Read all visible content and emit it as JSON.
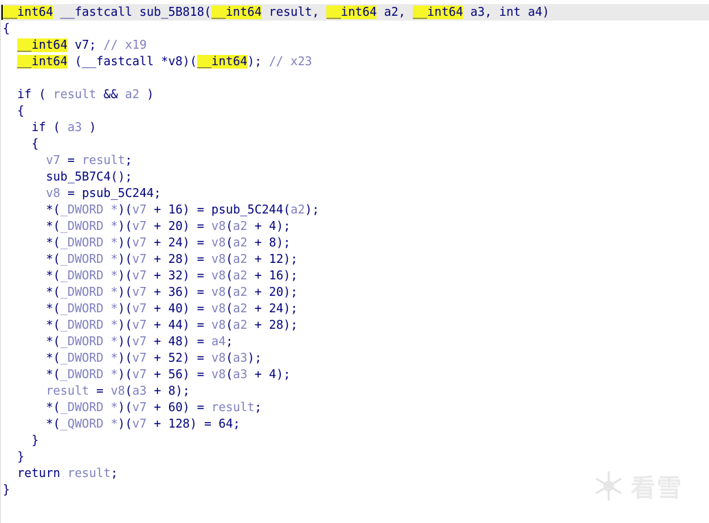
{
  "lines": [
    [
      [
        "hl",
        "__int64"
      ],
      [
        "t",
        " __fastcall sub_5B818("
      ],
      [
        "hl",
        "__int64"
      ],
      [
        "t",
        " result, "
      ],
      [
        "hl",
        "__int64"
      ],
      [
        "t",
        " a2, "
      ],
      [
        "hl",
        "__int64"
      ],
      [
        "t",
        " a3, int a4)"
      ]
    ],
    [
      [
        "t",
        "{"
      ]
    ],
    [
      [
        "t",
        "  "
      ],
      [
        "hl",
        "__int64"
      ],
      [
        "t",
        " v7; "
      ],
      [
        "c",
        "// x19"
      ]
    ],
    [
      [
        "t",
        "  "
      ],
      [
        "hl",
        "__int64"
      ],
      [
        "t",
        " (__fastcall *v8)("
      ],
      [
        "hl",
        "__int64"
      ],
      [
        "t",
        "); "
      ],
      [
        "c",
        "// x23"
      ]
    ],
    [
      [
        "t",
        ""
      ]
    ],
    [
      [
        "t",
        "  if ( "
      ],
      [
        "v",
        "result"
      ],
      [
        "t",
        " && "
      ],
      [
        "v",
        "a2"
      ],
      [
        "t",
        " )"
      ]
    ],
    [
      [
        "t",
        "  {"
      ]
    ],
    [
      [
        "t",
        "    if ( "
      ],
      [
        "v",
        "a3"
      ],
      [
        "t",
        " )"
      ]
    ],
    [
      [
        "t",
        "    {"
      ]
    ],
    [
      [
        "t",
        "      "
      ],
      [
        "v",
        "v7"
      ],
      [
        "t",
        " = "
      ],
      [
        "v",
        "result"
      ],
      [
        "t",
        ";"
      ]
    ],
    [
      [
        "t",
        "      sub_5B7C4();"
      ]
    ],
    [
      [
        "t",
        "      "
      ],
      [
        "v",
        "v8"
      ],
      [
        "t",
        " = psub_5C244;"
      ]
    ],
    [
      [
        "t",
        "      *("
      ],
      [
        "v",
        "_DWORD *"
      ],
      [
        "t",
        ")("
      ],
      [
        "v",
        "v7"
      ],
      [
        "t",
        " + 16) = psub_5C244("
      ],
      [
        "v",
        "a2"
      ],
      [
        "t",
        ");"
      ]
    ],
    [
      [
        "t",
        "      *("
      ],
      [
        "v",
        "_DWORD *"
      ],
      [
        "t",
        ")("
      ],
      [
        "v",
        "v7"
      ],
      [
        "t",
        " + 20) = "
      ],
      [
        "v",
        "v8"
      ],
      [
        "t",
        "("
      ],
      [
        "v",
        "a2"
      ],
      [
        "t",
        " + 4);"
      ]
    ],
    [
      [
        "t",
        "      *("
      ],
      [
        "v",
        "_DWORD *"
      ],
      [
        "t",
        ")("
      ],
      [
        "v",
        "v7"
      ],
      [
        "t",
        " + 24) = "
      ],
      [
        "v",
        "v8"
      ],
      [
        "t",
        "("
      ],
      [
        "v",
        "a2"
      ],
      [
        "t",
        " + 8);"
      ]
    ],
    [
      [
        "t",
        "      *("
      ],
      [
        "v",
        "_DWORD *"
      ],
      [
        "t",
        ")("
      ],
      [
        "v",
        "v7"
      ],
      [
        "t",
        " + 28) = "
      ],
      [
        "v",
        "v8"
      ],
      [
        "t",
        "("
      ],
      [
        "v",
        "a2"
      ],
      [
        "t",
        " + 12);"
      ]
    ],
    [
      [
        "t",
        "      *("
      ],
      [
        "v",
        "_DWORD *"
      ],
      [
        "t",
        ")("
      ],
      [
        "v",
        "v7"
      ],
      [
        "t",
        " + 32) = "
      ],
      [
        "v",
        "v8"
      ],
      [
        "t",
        "("
      ],
      [
        "v",
        "a2"
      ],
      [
        "t",
        " + 16);"
      ]
    ],
    [
      [
        "t",
        "      *("
      ],
      [
        "v",
        "_DWORD *"
      ],
      [
        "t",
        ")("
      ],
      [
        "v",
        "v7"
      ],
      [
        "t",
        " + 36) = "
      ],
      [
        "v",
        "v8"
      ],
      [
        "t",
        "("
      ],
      [
        "v",
        "a2"
      ],
      [
        "t",
        " + 20);"
      ]
    ],
    [
      [
        "t",
        "      *("
      ],
      [
        "v",
        "_DWORD *"
      ],
      [
        "t",
        ")("
      ],
      [
        "v",
        "v7"
      ],
      [
        "t",
        " + 40) = "
      ],
      [
        "v",
        "v8"
      ],
      [
        "t",
        "("
      ],
      [
        "v",
        "a2"
      ],
      [
        "t",
        " + 24);"
      ]
    ],
    [
      [
        "t",
        "      *("
      ],
      [
        "v",
        "_DWORD *"
      ],
      [
        "t",
        ")("
      ],
      [
        "v",
        "v7"
      ],
      [
        "t",
        " + 44) = "
      ],
      [
        "v",
        "v8"
      ],
      [
        "t",
        "("
      ],
      [
        "v",
        "a2"
      ],
      [
        "t",
        " + 28);"
      ]
    ],
    [
      [
        "t",
        "      *("
      ],
      [
        "v",
        "_DWORD *"
      ],
      [
        "t",
        ")("
      ],
      [
        "v",
        "v7"
      ],
      [
        "t",
        " + 48) = "
      ],
      [
        "v",
        "a4"
      ],
      [
        "t",
        ";"
      ]
    ],
    [
      [
        "t",
        "      *("
      ],
      [
        "v",
        "_DWORD *"
      ],
      [
        "t",
        ")("
      ],
      [
        "v",
        "v7"
      ],
      [
        "t",
        " + 52) = "
      ],
      [
        "v",
        "v8"
      ],
      [
        "t",
        "("
      ],
      [
        "v",
        "a3"
      ],
      [
        "t",
        ");"
      ]
    ],
    [
      [
        "t",
        "      *("
      ],
      [
        "v",
        "_DWORD *"
      ],
      [
        "t",
        ")("
      ],
      [
        "v",
        "v7"
      ],
      [
        "t",
        " + 56) = "
      ],
      [
        "v",
        "v8"
      ],
      [
        "t",
        "("
      ],
      [
        "v",
        "a3"
      ],
      [
        "t",
        " + 4);"
      ]
    ],
    [
      [
        "t",
        "      "
      ],
      [
        "v",
        "result"
      ],
      [
        "t",
        " = "
      ],
      [
        "v",
        "v8"
      ],
      [
        "t",
        "("
      ],
      [
        "v",
        "a3"
      ],
      [
        "t",
        " + 8);"
      ]
    ],
    [
      [
        "t",
        "      *("
      ],
      [
        "v",
        "_DWORD *"
      ],
      [
        "t",
        ")("
      ],
      [
        "v",
        "v7"
      ],
      [
        "t",
        " + 60) = "
      ],
      [
        "v",
        "result"
      ],
      [
        "t",
        ";"
      ]
    ],
    [
      [
        "t",
        "      *("
      ],
      [
        "v",
        "_QWORD *"
      ],
      [
        "t",
        ")("
      ],
      [
        "v",
        "v7"
      ],
      [
        "t",
        " + 128) = 64;"
      ]
    ],
    [
      [
        "t",
        "    }"
      ]
    ],
    [
      [
        "t",
        "  }"
      ]
    ],
    [
      [
        "t",
        "  return "
      ],
      [
        "v",
        "result"
      ],
      [
        "t",
        ";"
      ]
    ],
    [
      [
        "t",
        "}"
      ]
    ]
  ],
  "watermark": {
    "text": "看雪",
    "icon": "snowflake-icon"
  },
  "colors": {
    "keyword": "#000080",
    "variable": "#7f7fbf",
    "highlight": "#f6f628",
    "header_bg": "#eaeaea"
  }
}
